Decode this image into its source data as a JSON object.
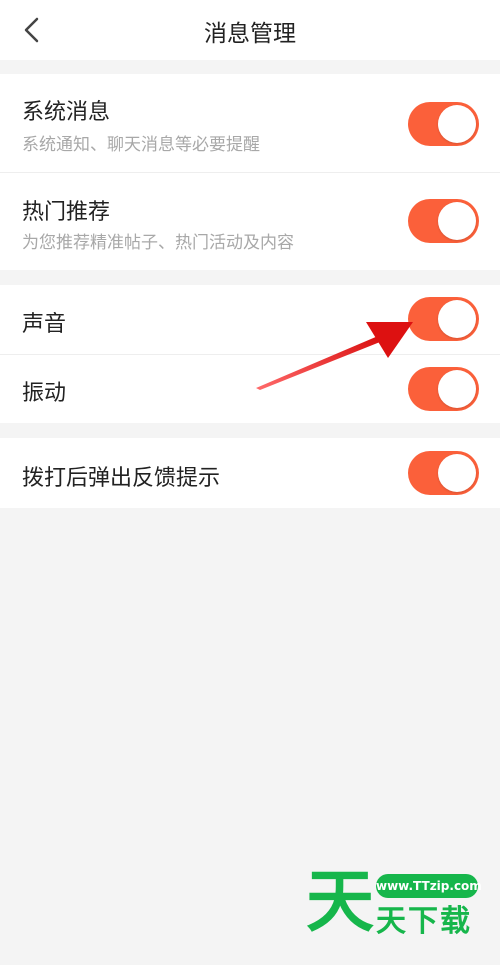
{
  "header": {
    "title": "消息管理",
    "back_icon": "chevron-left-icon"
  },
  "colors": {
    "toggle_on": "#fb603a",
    "background": "#f4f4f4",
    "arrow": "#e11a1a",
    "watermark": "#16b64b"
  },
  "groups": [
    {
      "items": [
        {
          "title": "系统消息",
          "subtitle": "系统通知、聊天消息等必要提醒",
          "enabled": true
        },
        {
          "title": "热门推荐",
          "subtitle": "为您推荐精准帖子、热门活动及内容",
          "enabled": true
        }
      ]
    },
    {
      "items": [
        {
          "title": "声音",
          "enabled": true
        },
        {
          "title": "振动",
          "enabled": true
        }
      ]
    },
    {
      "items": [
        {
          "title": "拨打后弹出反馈提示",
          "enabled": true
        }
      ]
    }
  ],
  "watermark": {
    "big_char": "天",
    "url": "www.TTzip.com",
    "text": "天下载"
  }
}
